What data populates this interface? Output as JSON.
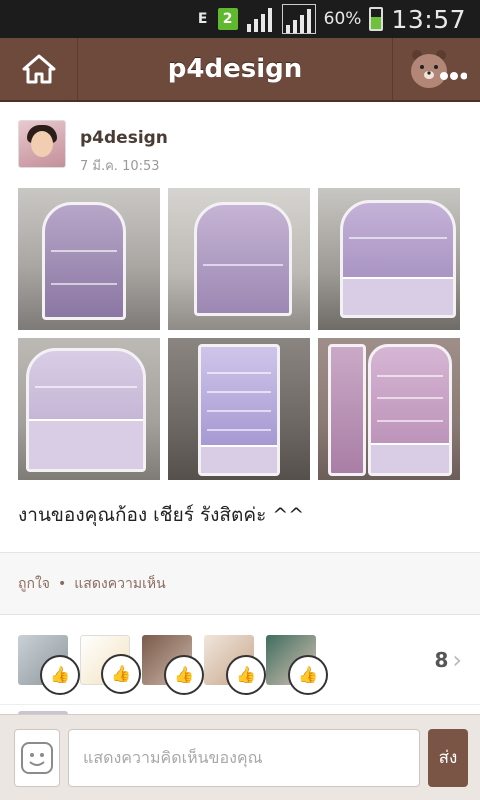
{
  "status_bar": {
    "network": "E",
    "sim_badge": "2",
    "battery": "60%",
    "time": "13:57"
  },
  "header": {
    "title": "p4design",
    "home_icon": "home-icon",
    "more_icon": "bear-more-icon"
  },
  "post": {
    "author": "p4design",
    "timestamp": "7 มี.ค. 10:53",
    "caption": "งานของคุณก้อง เชียร์ รังสิตค่ะ  ^^",
    "photo_count": 6
  },
  "actions": {
    "like": "ถูกใจ",
    "separator": "•",
    "comment": "แสดงความเห็น"
  },
  "likes": {
    "count": "8",
    "chevron": "›"
  },
  "composer": {
    "placeholder": "แสดงความคิดเห็นของคุณ",
    "send": "ส่ง"
  },
  "colors": {
    "header_bg": "#6d4a3c",
    "accent_text": "#8b6d60",
    "send_bg": "#7a5546"
  }
}
